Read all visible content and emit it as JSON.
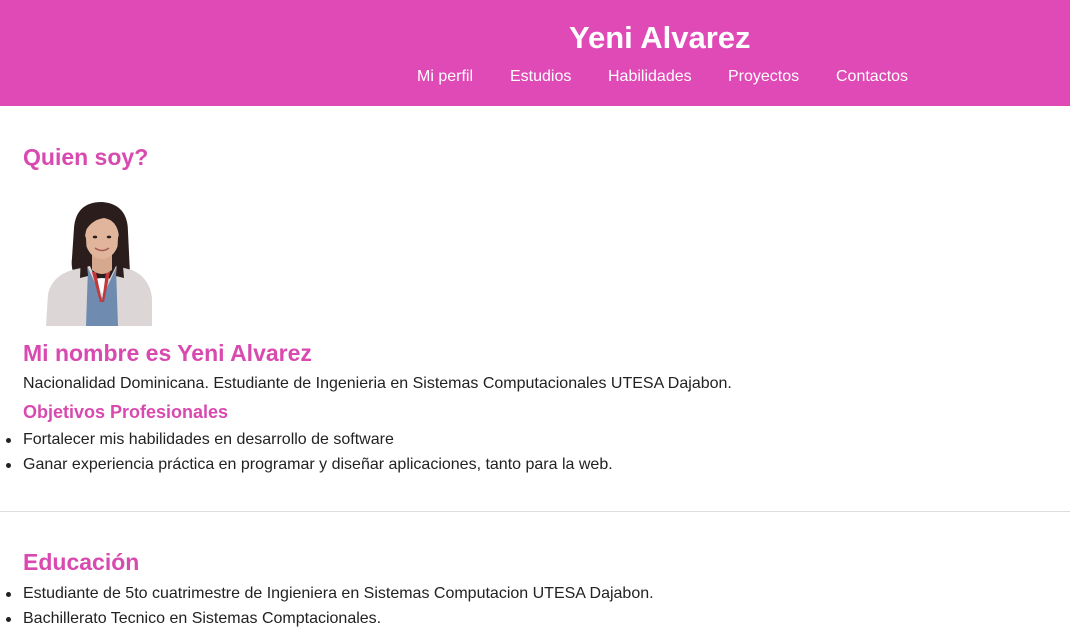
{
  "header": {
    "title": "Yeni Alvarez",
    "bg_color": "#e04ab6",
    "nav": [
      "Mi perfil",
      "Estudios",
      "Habilidades",
      "Proyectos",
      "Contactos"
    ]
  },
  "about": {
    "heading": "Quien soy?",
    "avatar_icon": "profile-photo",
    "name_heading": "Mi nombre es Yeni Alvarez",
    "bio": "Nacionalidad Dominicana. Estudiante de Ingenieria en Sistemas Computacionales UTESA Dajabon.",
    "objectives_heading": "Objetivos Profesionales",
    "objectives": [
      "Fortalecer mis habilidades en desarrollo de software",
      "Ganar experiencia práctica en programar y diseñar aplicaciones, tanto para la web."
    ]
  },
  "education": {
    "heading": "Educación",
    "items": [
      "Estudiante de 5to cuatrimestre de Ingieniera en Sistemas Computacion UTESA Dajabon.",
      "Bachillerato Tecnico en Sistemas Comptacionales."
    ]
  },
  "colors": {
    "accent": "#d84aaf"
  }
}
